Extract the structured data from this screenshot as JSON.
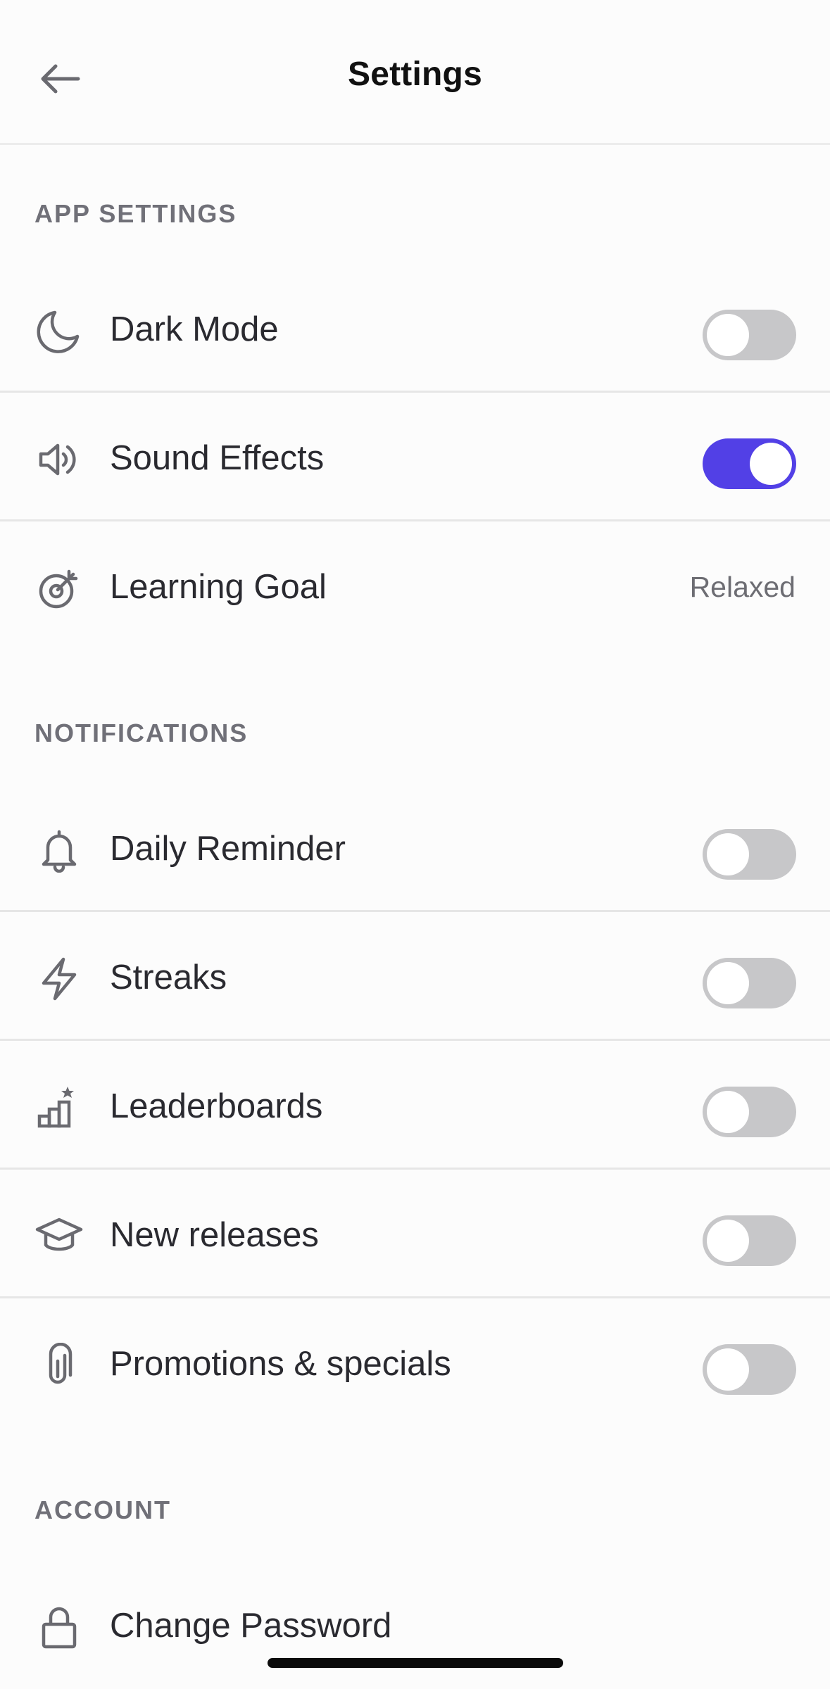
{
  "header": {
    "title": "Settings",
    "back_icon": "arrow-left-icon"
  },
  "sections": {
    "app_settings": {
      "title": "APP SETTINGS",
      "items": [
        {
          "label": "Dark Mode",
          "icon": "moon-icon",
          "control": "toggle",
          "on": false
        },
        {
          "label": "Sound Effects",
          "icon": "speaker-icon",
          "control": "toggle",
          "on": true
        },
        {
          "label": "Learning Goal",
          "icon": "target-icon",
          "control": "value",
          "value": "Relaxed"
        }
      ]
    },
    "notifications": {
      "title": "NOTIFICATIONS",
      "items": [
        {
          "label": "Daily Reminder",
          "icon": "bell-icon",
          "control": "toggle",
          "on": false
        },
        {
          "label": "Streaks",
          "icon": "lightning-icon",
          "control": "toggle",
          "on": false
        },
        {
          "label": "Leaderboards",
          "icon": "leaderboard-icon",
          "control": "toggle",
          "on": false
        },
        {
          "label": "New releases",
          "icon": "graduation-cap-icon",
          "control": "toggle",
          "on": false
        },
        {
          "label": "Promotions & specials",
          "icon": "paperclip-icon",
          "control": "toggle",
          "on": false
        }
      ]
    },
    "account": {
      "title": "ACCOUNT",
      "items": [
        {
          "label": "Change Password",
          "icon": "lock-icon",
          "control": "none"
        }
      ]
    }
  },
  "colors": {
    "accent": "#5240e6",
    "toggle_off": "#c7c7c9",
    "section_header": "#707078",
    "icon": "#6a6a70"
  }
}
